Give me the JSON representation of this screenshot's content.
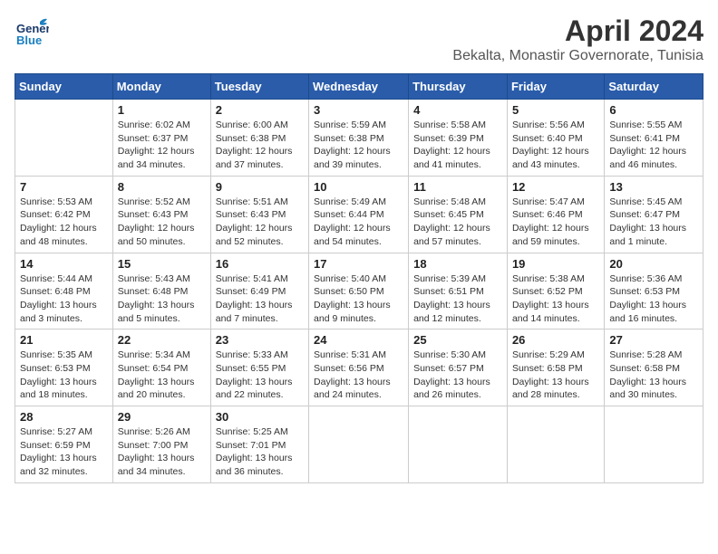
{
  "header": {
    "logo_general": "General",
    "logo_blue": "Blue",
    "title": "April 2024",
    "subtitle": "Bekalta, Monastir Governorate, Tunisia"
  },
  "weekdays": [
    "Sunday",
    "Monday",
    "Tuesday",
    "Wednesday",
    "Thursday",
    "Friday",
    "Saturday"
  ],
  "weeks": [
    [
      {
        "day": "",
        "info": ""
      },
      {
        "day": "1",
        "info": "Sunrise: 6:02 AM\nSunset: 6:37 PM\nDaylight: 12 hours\nand 34 minutes."
      },
      {
        "day": "2",
        "info": "Sunrise: 6:00 AM\nSunset: 6:38 PM\nDaylight: 12 hours\nand 37 minutes."
      },
      {
        "day": "3",
        "info": "Sunrise: 5:59 AM\nSunset: 6:38 PM\nDaylight: 12 hours\nand 39 minutes."
      },
      {
        "day": "4",
        "info": "Sunrise: 5:58 AM\nSunset: 6:39 PM\nDaylight: 12 hours\nand 41 minutes."
      },
      {
        "day": "5",
        "info": "Sunrise: 5:56 AM\nSunset: 6:40 PM\nDaylight: 12 hours\nand 43 minutes."
      },
      {
        "day": "6",
        "info": "Sunrise: 5:55 AM\nSunset: 6:41 PM\nDaylight: 12 hours\nand 46 minutes."
      }
    ],
    [
      {
        "day": "7",
        "info": "Sunrise: 5:53 AM\nSunset: 6:42 PM\nDaylight: 12 hours\nand 48 minutes."
      },
      {
        "day": "8",
        "info": "Sunrise: 5:52 AM\nSunset: 6:43 PM\nDaylight: 12 hours\nand 50 minutes."
      },
      {
        "day": "9",
        "info": "Sunrise: 5:51 AM\nSunset: 6:43 PM\nDaylight: 12 hours\nand 52 minutes."
      },
      {
        "day": "10",
        "info": "Sunrise: 5:49 AM\nSunset: 6:44 PM\nDaylight: 12 hours\nand 54 minutes."
      },
      {
        "day": "11",
        "info": "Sunrise: 5:48 AM\nSunset: 6:45 PM\nDaylight: 12 hours\nand 57 minutes."
      },
      {
        "day": "12",
        "info": "Sunrise: 5:47 AM\nSunset: 6:46 PM\nDaylight: 12 hours\nand 59 minutes."
      },
      {
        "day": "13",
        "info": "Sunrise: 5:45 AM\nSunset: 6:47 PM\nDaylight: 13 hours\nand 1 minute."
      }
    ],
    [
      {
        "day": "14",
        "info": "Sunrise: 5:44 AM\nSunset: 6:48 PM\nDaylight: 13 hours\nand 3 minutes."
      },
      {
        "day": "15",
        "info": "Sunrise: 5:43 AM\nSunset: 6:48 PM\nDaylight: 13 hours\nand 5 minutes."
      },
      {
        "day": "16",
        "info": "Sunrise: 5:41 AM\nSunset: 6:49 PM\nDaylight: 13 hours\nand 7 minutes."
      },
      {
        "day": "17",
        "info": "Sunrise: 5:40 AM\nSunset: 6:50 PM\nDaylight: 13 hours\nand 9 minutes."
      },
      {
        "day": "18",
        "info": "Sunrise: 5:39 AM\nSunset: 6:51 PM\nDaylight: 13 hours\nand 12 minutes."
      },
      {
        "day": "19",
        "info": "Sunrise: 5:38 AM\nSunset: 6:52 PM\nDaylight: 13 hours\nand 14 minutes."
      },
      {
        "day": "20",
        "info": "Sunrise: 5:36 AM\nSunset: 6:53 PM\nDaylight: 13 hours\nand 16 minutes."
      }
    ],
    [
      {
        "day": "21",
        "info": "Sunrise: 5:35 AM\nSunset: 6:53 PM\nDaylight: 13 hours\nand 18 minutes."
      },
      {
        "day": "22",
        "info": "Sunrise: 5:34 AM\nSunset: 6:54 PM\nDaylight: 13 hours\nand 20 minutes."
      },
      {
        "day": "23",
        "info": "Sunrise: 5:33 AM\nSunset: 6:55 PM\nDaylight: 13 hours\nand 22 minutes."
      },
      {
        "day": "24",
        "info": "Sunrise: 5:31 AM\nSunset: 6:56 PM\nDaylight: 13 hours\nand 24 minutes."
      },
      {
        "day": "25",
        "info": "Sunrise: 5:30 AM\nSunset: 6:57 PM\nDaylight: 13 hours\nand 26 minutes."
      },
      {
        "day": "26",
        "info": "Sunrise: 5:29 AM\nSunset: 6:58 PM\nDaylight: 13 hours\nand 28 minutes."
      },
      {
        "day": "27",
        "info": "Sunrise: 5:28 AM\nSunset: 6:58 PM\nDaylight: 13 hours\nand 30 minutes."
      }
    ],
    [
      {
        "day": "28",
        "info": "Sunrise: 5:27 AM\nSunset: 6:59 PM\nDaylight: 13 hours\nand 32 minutes."
      },
      {
        "day": "29",
        "info": "Sunrise: 5:26 AM\nSunset: 7:00 PM\nDaylight: 13 hours\nand 34 minutes."
      },
      {
        "day": "30",
        "info": "Sunrise: 5:25 AM\nSunset: 7:01 PM\nDaylight: 13 hours\nand 36 minutes."
      },
      {
        "day": "",
        "info": ""
      },
      {
        "day": "",
        "info": ""
      },
      {
        "day": "",
        "info": ""
      },
      {
        "day": "",
        "info": ""
      }
    ]
  ]
}
